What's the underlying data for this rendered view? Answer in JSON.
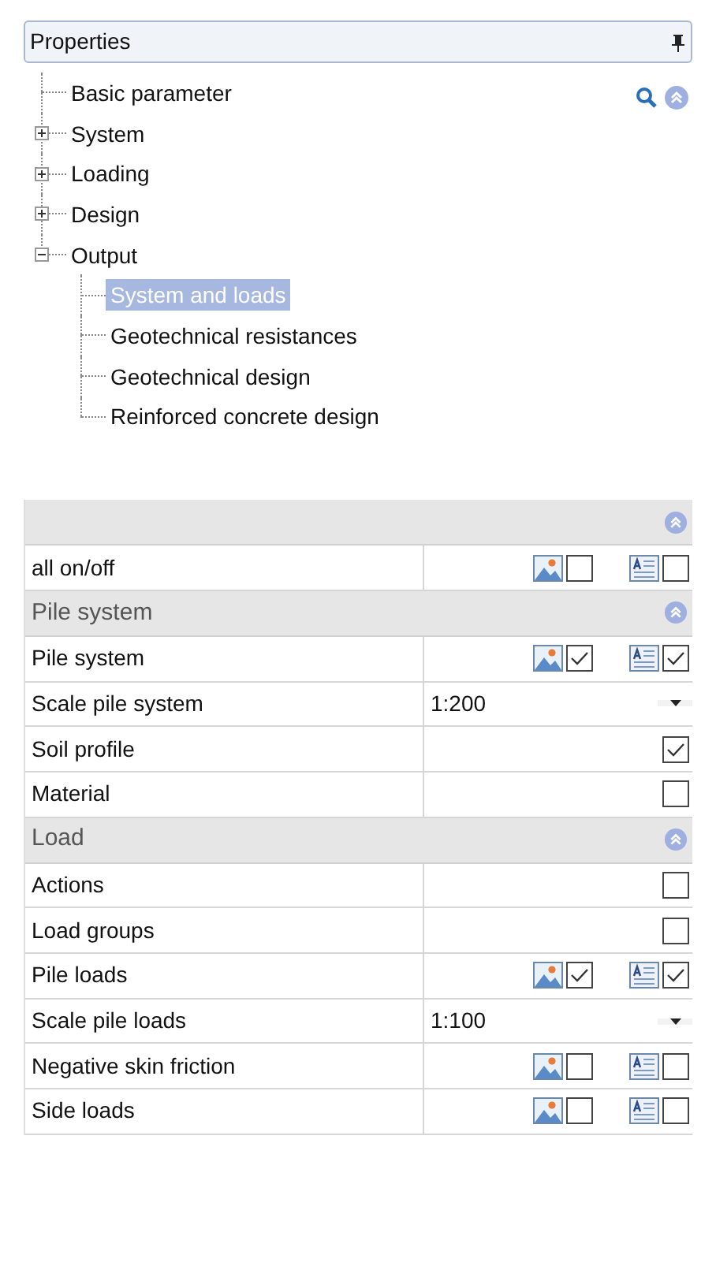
{
  "panel": {
    "title": "Properties",
    "pinned": true
  },
  "tree": [
    {
      "label": "Basic parameter",
      "selected": false
    },
    {
      "label": "System",
      "expanded": false,
      "selected": false
    },
    {
      "label": "Loading",
      "expanded": false,
      "selected": false
    },
    {
      "label": "Design",
      "expanded": false,
      "selected": false
    },
    {
      "label": "Output",
      "expanded": true,
      "selected": false,
      "children": [
        {
          "label": "System and loads",
          "selected": true
        },
        {
          "label": "Geotechnical resistances",
          "selected": false
        },
        {
          "label": "Geotechnical design",
          "selected": false
        },
        {
          "label": "Reinforced concrete design",
          "selected": false
        }
      ]
    }
  ],
  "grid": [
    {
      "expanded": true,
      "rows": [
        {
          "kind": "pair",
          "label": "all on/off",
          "graphic": false,
          "text": false
        }
      ]
    },
    {
      "title": "Pile system",
      "expanded": true,
      "rows": [
        {
          "kind": "pair",
          "label": "Pile system",
          "graphic": true,
          "text": true
        },
        {
          "kind": "combo",
          "label": "Scale pile system",
          "value": "1:200"
        },
        {
          "kind": "check",
          "label": "Soil profile",
          "checked": true
        },
        {
          "kind": "check",
          "label": "Material",
          "checked": false
        }
      ]
    },
    {
      "title": "Load",
      "expanded": true,
      "rows": [
        {
          "kind": "check",
          "label": "Actions",
          "checked": false
        },
        {
          "kind": "check",
          "label": "Load groups",
          "checked": false
        },
        {
          "kind": "pair",
          "label": "Pile loads",
          "graphic": true,
          "text": true
        },
        {
          "kind": "combo",
          "label": "Scale pile loads",
          "value": "1:100"
        },
        {
          "kind": "pair",
          "label": "Negative skin friction",
          "graphic": false,
          "text": false
        },
        {
          "kind": "pair",
          "label": "Side loads",
          "graphic": false,
          "text": false
        }
      ]
    }
  ]
}
